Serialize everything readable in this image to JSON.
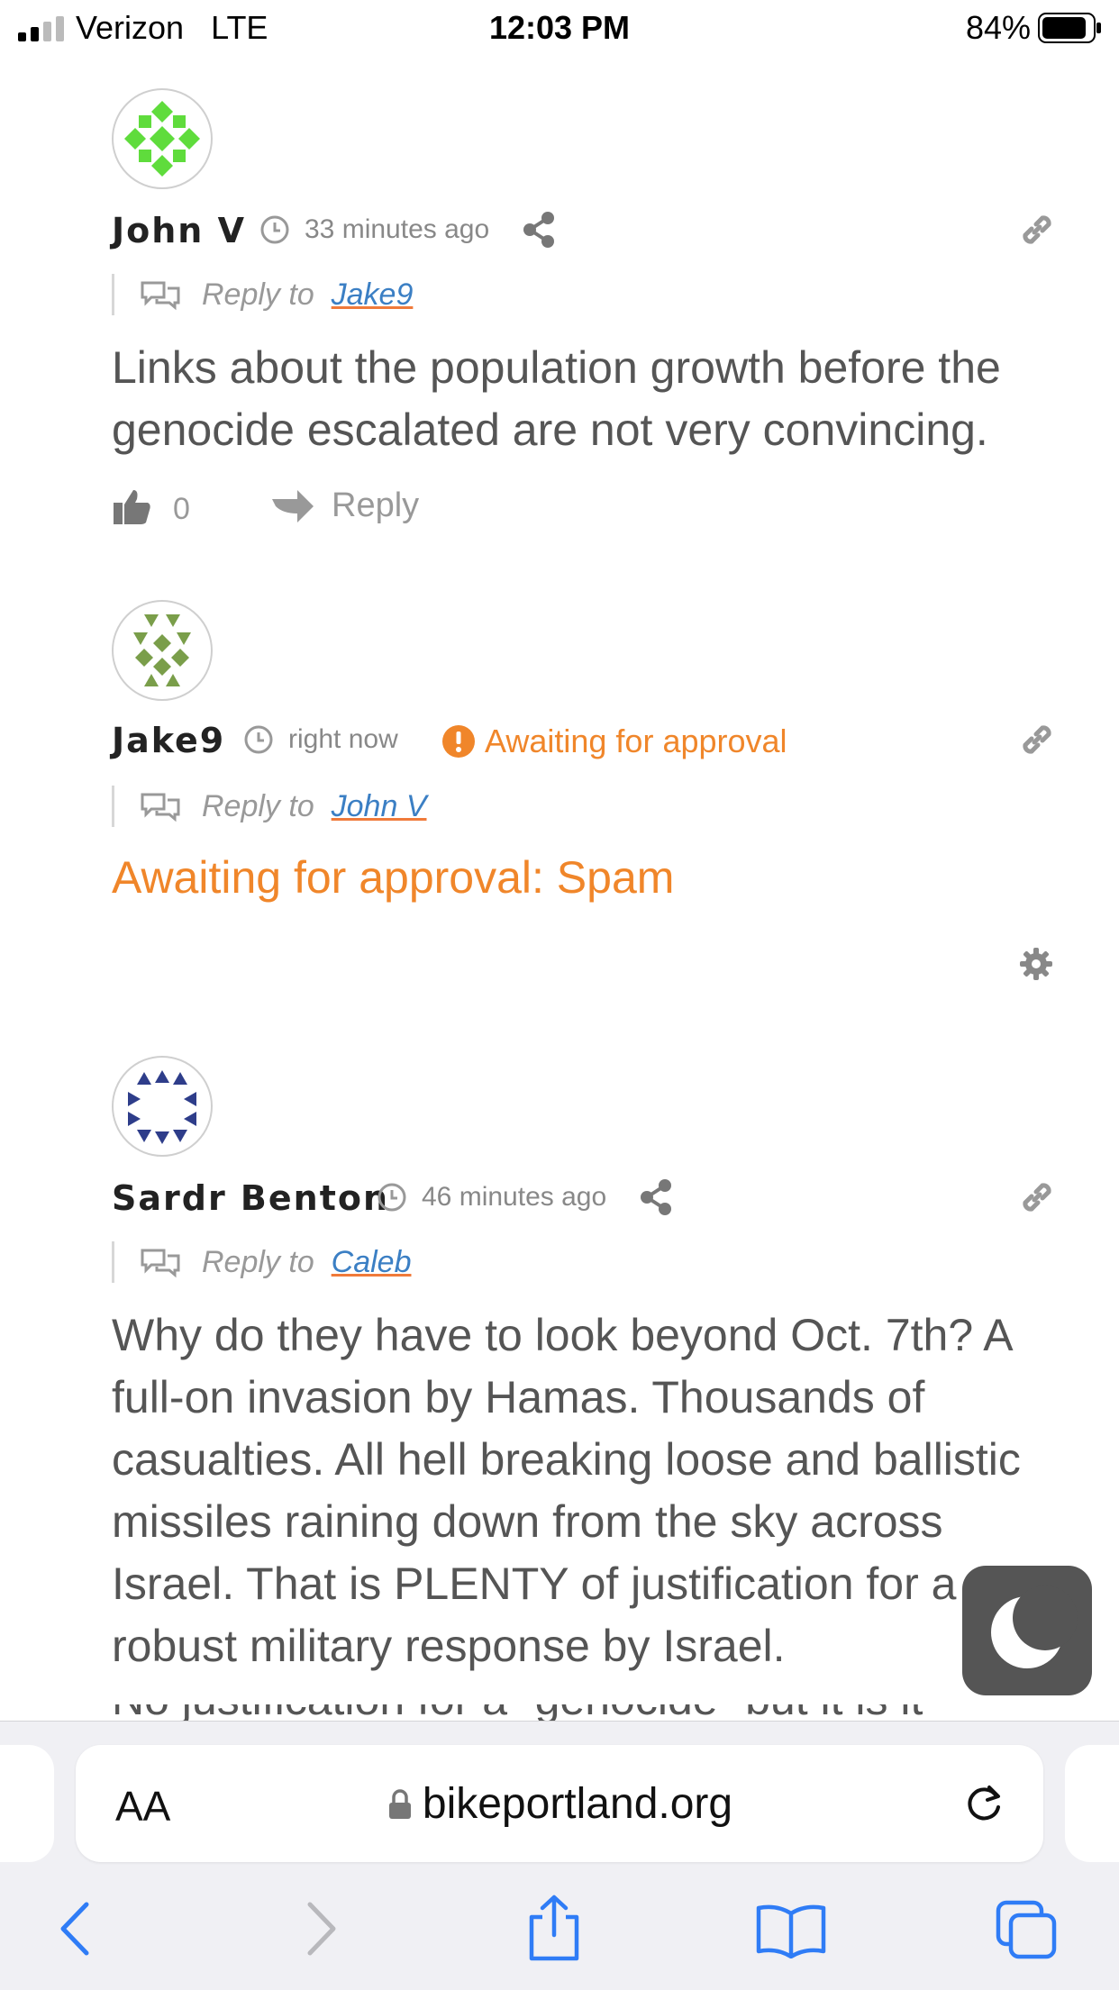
{
  "status_bar": {
    "carrier": "Verizon",
    "network": "LTE",
    "time": "12:03 PM",
    "battery": "84%"
  },
  "comments": [
    {
      "author": "John V",
      "time": "33 minutes ago",
      "reply_prefix": "Reply to",
      "reply_to": "Jake9",
      "body": "Links about the population growth before the genocide escalated are not very convincing.",
      "likes": "0",
      "reply_label": "Reply",
      "avatar_color": "#5fdc3c"
    },
    {
      "author": "Jake9",
      "time": "right now",
      "status_badge": "Awaiting for approval",
      "reply_prefix": "Reply to",
      "reply_to": "John V",
      "body": "Awaiting for approval: Spam",
      "avatar_color": "#7a9e4a"
    },
    {
      "author": "Sardr Benton",
      "time": "46 minutes ago",
      "reply_prefix": "Reply to",
      "reply_to": "Caleb",
      "body": "Why do they have to look beyond Oct. 7th? A full-on invasion by Hamas. Thousands of casualties. All hell breaking loose and ballistic missiles raining down from the sky across Israel. That is PLENTY of justification for a robust military response by Israel.",
      "partial_next_line": "No justification for a “genocide” but it is it",
      "avatar_color": "#2e3d8a"
    }
  ],
  "browser": {
    "text_size_label": "AA",
    "url": "bikeportland.org"
  },
  "colors": {
    "link": "#3b7fc4",
    "pending": "#f0862a",
    "text": "#555555"
  }
}
